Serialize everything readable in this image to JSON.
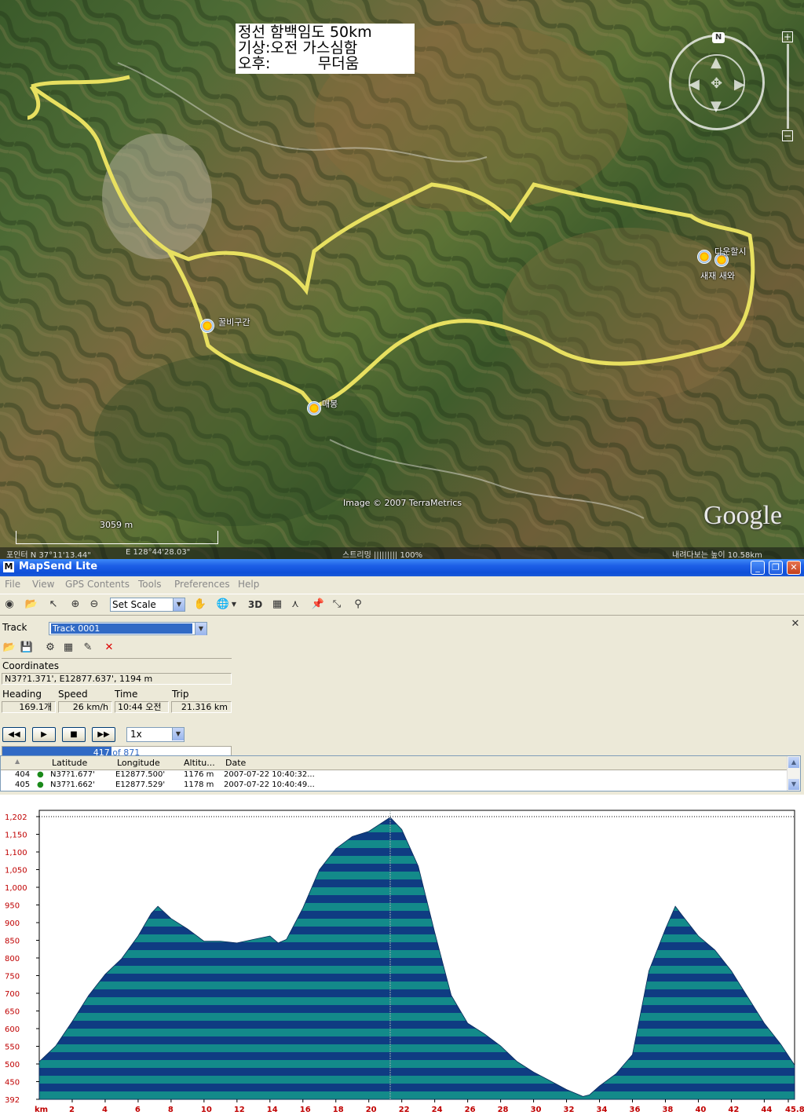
{
  "map": {
    "title_lines": [
      "정선 함백임도 50km",
      "기상:오전 가스심함",
      "오후:          무더움"
    ],
    "imagery_credit": "Image © 2007 TerraMetrics",
    "google_logo": "Google",
    "scale_label": "3059 m",
    "status": {
      "pointer": "포인터 N 37°11'13.44\"",
      "longitude": "E 128°44'28.03\"",
      "streaming": "스트리밍 ||||||||| 100%",
      "eye_alt": "내려다보는 높이   10.58km"
    },
    "waypoints": [
      {
        "label": "꿀비구간"
      },
      {
        "label": "매봉"
      },
      {
        "label": "다운할시"
      },
      {
        "label": "새재 새와"
      }
    ],
    "compass_n": "N",
    "zoom_plus": "+",
    "zoom_minus": "−"
  },
  "window": {
    "title": "MapSend Lite",
    "menu": [
      "File",
      "View",
      "GPS Contents",
      "Tools",
      "Preferences",
      "Help"
    ],
    "scale_select": "Set Scale",
    "btn_3d": "3D"
  },
  "panel": {
    "track_label": "Track",
    "track_value": "Track 0001",
    "coordinates_label": "Coordinates",
    "coordinates_value": "N37?1.371',  E12877.637',  1194 m",
    "heading_label": "Heading",
    "speed_label": "Speed",
    "time_label": "Time",
    "trip_label": "Trip",
    "heading_value": "169.1개",
    "speed_value": "26 km/h",
    "time_value": "10:44 오전",
    "trip_value": "21.316 km",
    "speed_multiplier": "1x",
    "progress_current": "417",
    "progress_total_text": " of 871",
    "progress_fraction": 0.479
  },
  "table": {
    "columns": [
      "Latitude",
      "Longitude",
      "Altitu...",
      "Date"
    ],
    "rows": [
      {
        "id": "404",
        "lat": "N37?1.677'",
        "lon": "E12877.500'",
        "alt": "1176 m",
        "date": "2007-07-22  10:40:32..."
      },
      {
        "id": "405",
        "lat": "N37?1.662'",
        "lon": "E12877.529'",
        "alt": "1178 m",
        "date": "2007-07-22  10:40:49..."
      }
    ]
  },
  "chart_data": {
    "type": "area",
    "title": "",
    "xlabel": "km",
    "ylabel": "",
    "xlim": [
      0,
      45.84
    ],
    "ylim": [
      392,
      1202
    ],
    "x_ticks": [
      "km",
      "2",
      "4",
      "6",
      "8",
      "10",
      "12",
      "14",
      "16",
      "18",
      "20",
      "22",
      "24",
      "26",
      "28",
      "30",
      "32",
      "34",
      "36",
      "38",
      "40",
      "42",
      "44",
      "45.84"
    ],
    "y_ticks": [
      "1,202",
      "1,150",
      "1,100",
      "1,050",
      "1,000",
      "950",
      "900",
      "850",
      "800",
      "750",
      "700",
      "650",
      "600",
      "550",
      "500",
      "450",
      "392"
    ],
    "cursor_km": 21.3,
    "band_colors": [
      "#138a8a",
      "#0f3c82"
    ],
    "x": [
      0,
      1,
      2,
      3,
      4,
      5,
      6,
      6.8,
      7.2,
      8,
      9,
      10,
      11,
      12,
      13,
      14,
      14.5,
      15,
      16,
      17,
      18,
      19,
      20,
      21.3,
      22,
      23,
      24,
      25,
      26,
      27,
      28,
      29,
      30,
      31,
      32,
      33,
      33.4,
      34,
      35,
      36,
      37,
      38,
      38.6,
      39,
      40,
      41,
      42,
      43,
      44,
      45,
      45.84
    ],
    "y": [
      500,
      545,
      615,
      690,
      750,
      795,
      860,
      925,
      945,
      910,
      880,
      845,
      845,
      840,
      850,
      860,
      840,
      850,
      940,
      1050,
      1110,
      1145,
      1160,
      1200,
      1165,
      1060,
      870,
      690,
      610,
      580,
      545,
      500,
      470,
      445,
      420,
      400,
      405,
      430,
      465,
      520,
      760,
      880,
      945,
      920,
      860,
      820,
      760,
      685,
      610,
      550,
      490
    ]
  }
}
